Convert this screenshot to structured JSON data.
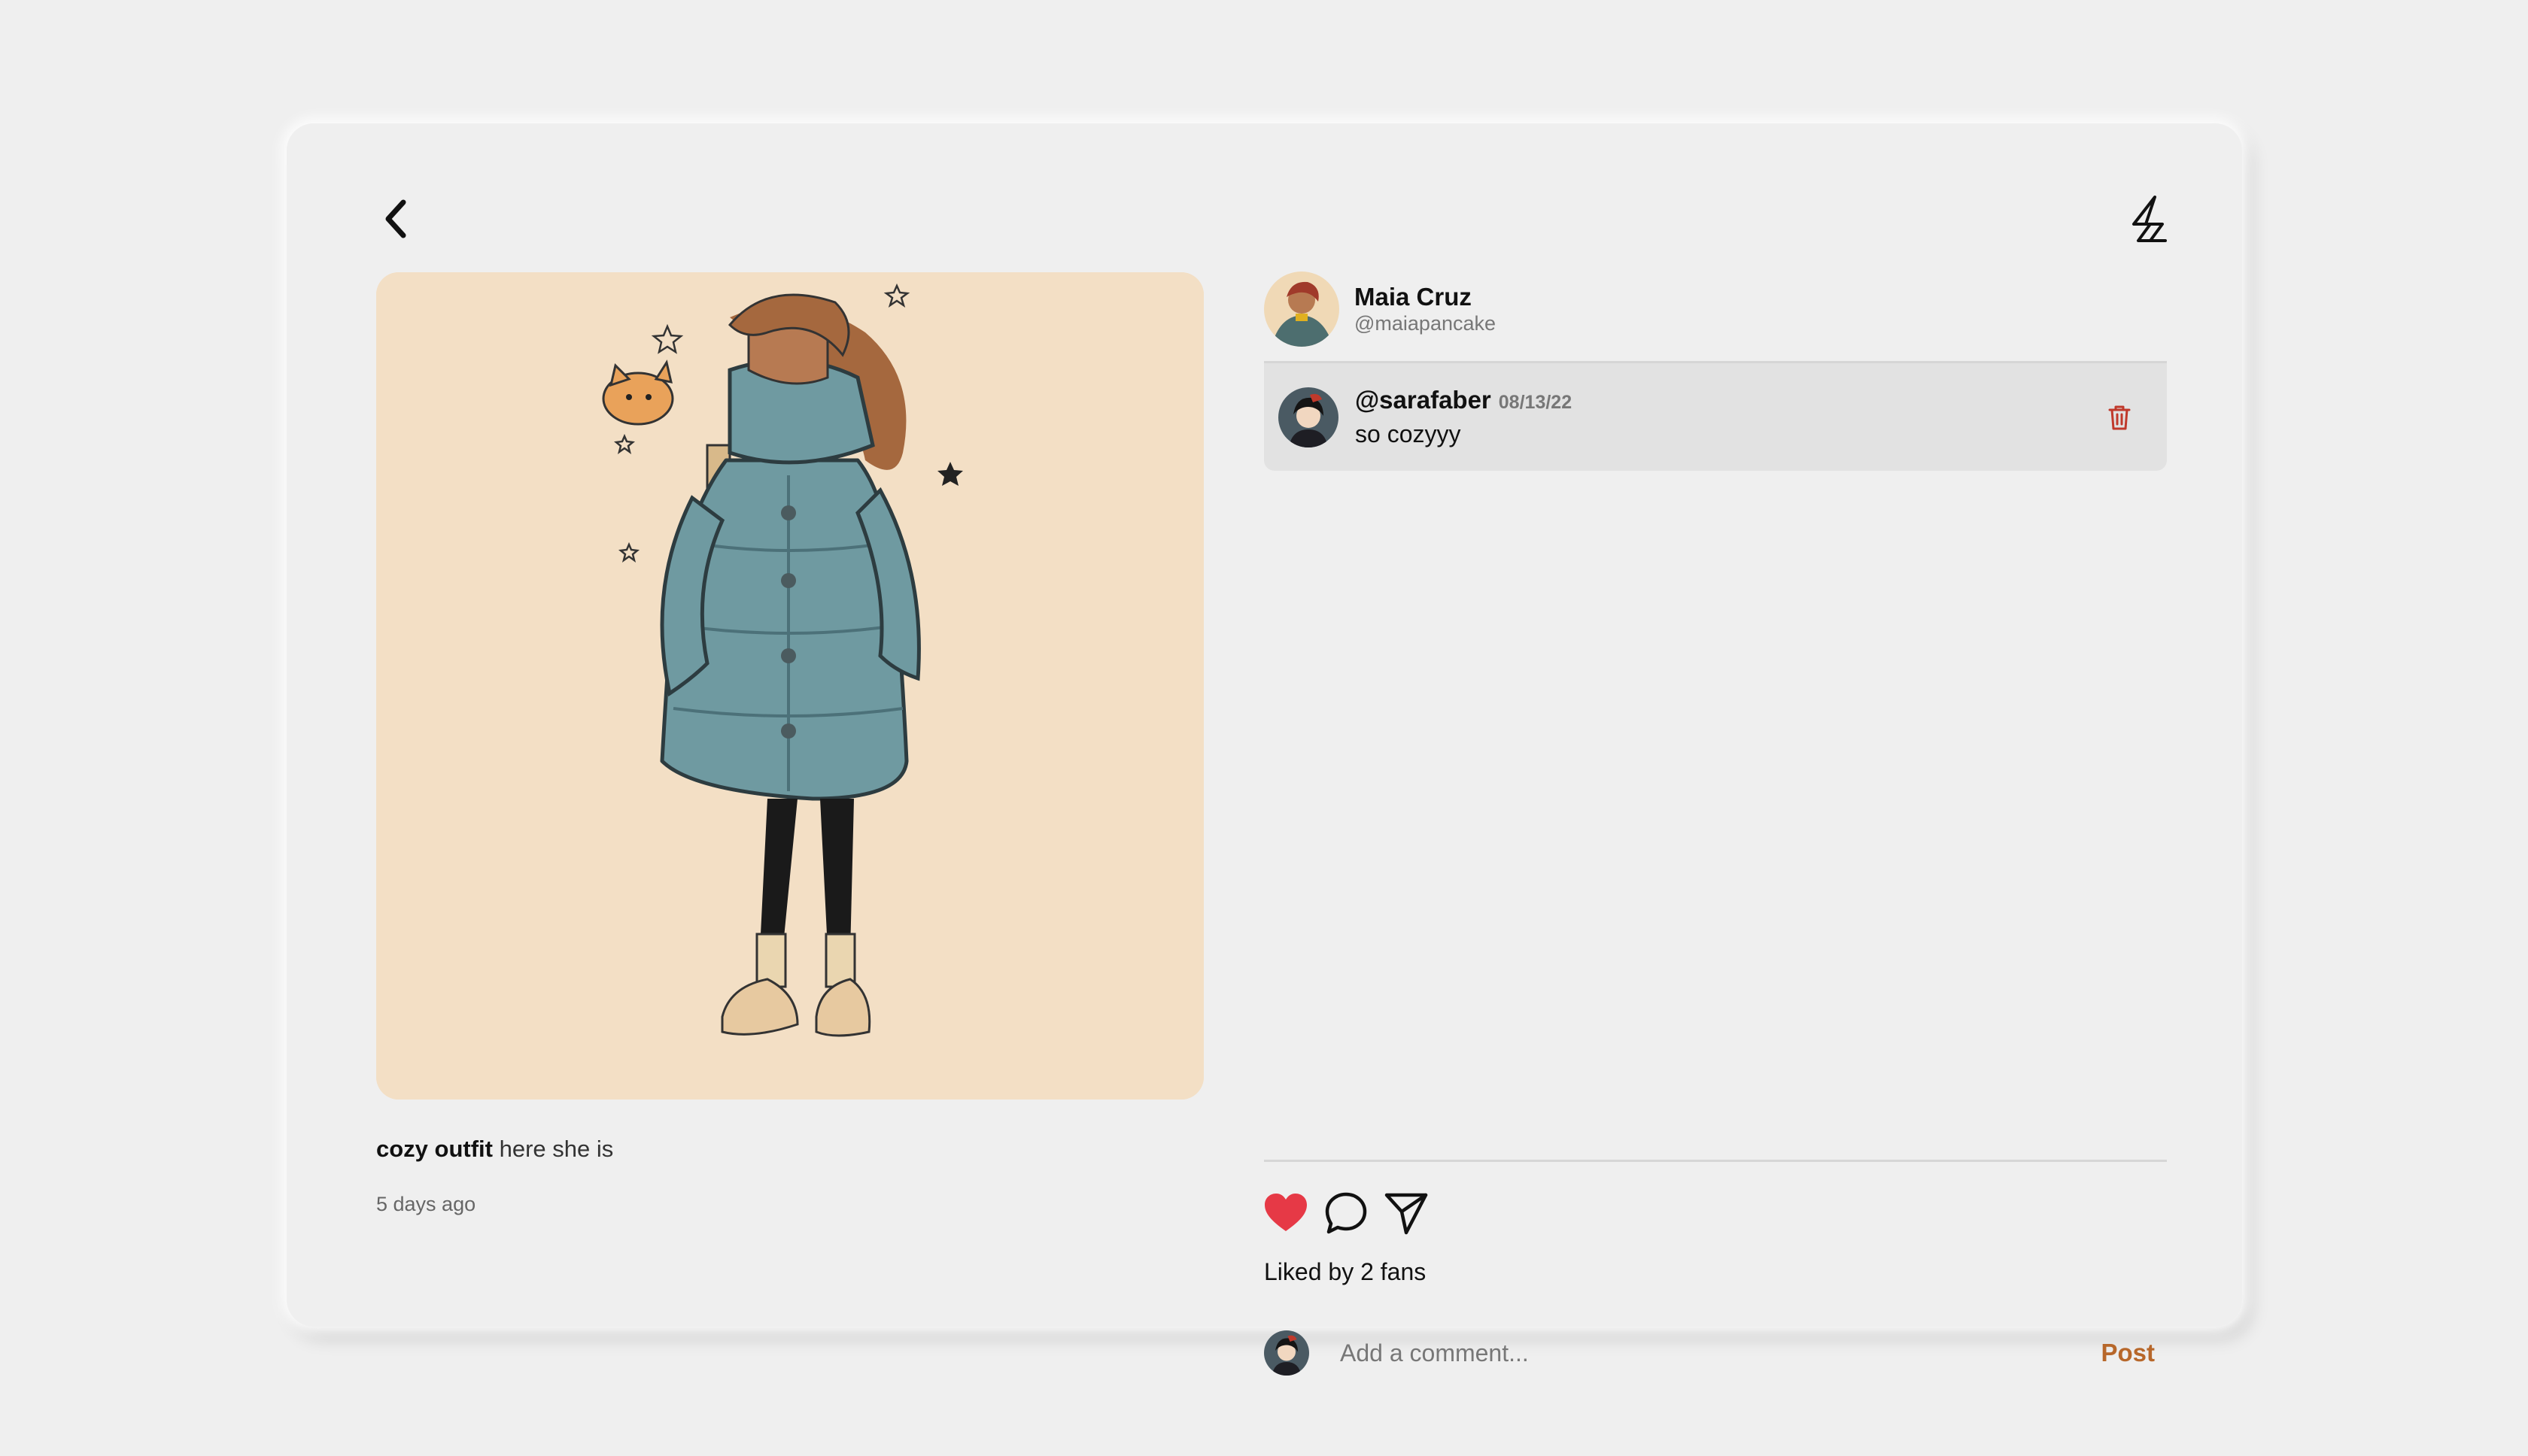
{
  "post": {
    "title": "cozy outfit",
    "caption": "here she is",
    "posted": "5 days ago",
    "image_alt": "illustration-girl-in-teal-coat"
  },
  "author": {
    "name": "Maia Cruz",
    "handle": "@maiapancake"
  },
  "comments": [
    {
      "user": "@sarafaber",
      "date": "08/13/22",
      "text": "so cozyyy"
    }
  ],
  "likes": {
    "prefix": "Liked by",
    "count": "2 fans"
  },
  "compose": {
    "placeholder": "Add a comment...",
    "post_label": "Post"
  },
  "icons": {
    "back": "chevron-left-icon",
    "logo": "bolt-logo-icon",
    "delete": "trash-icon",
    "like": "heart-icon",
    "comment": "speech-bubble-icon",
    "share": "paper-plane-icon"
  },
  "colors": {
    "background": "#efefef",
    "image_bg": "#f3dfc5",
    "comment_bg": "#e2e2e2",
    "heart": "#e63946",
    "post_button": "#b7672a",
    "delete": "#c0392b",
    "coat": "#6f9aa1"
  }
}
